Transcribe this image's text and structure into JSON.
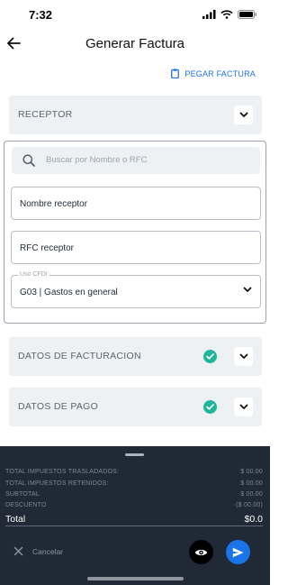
{
  "status": {
    "time": "7:32"
  },
  "header": {
    "title": "Generar Factura"
  },
  "paste": {
    "label": "PEGAR FACTURA"
  },
  "receptor": {
    "label": "RECEPTOR",
    "search_placeholder": "Buscar por Nombre o RFC",
    "name_value": "Nombre receptor",
    "rfc_value": "RFC receptor",
    "uso_label": "Uso CFDI",
    "uso_value": "G03 | Gastos en general"
  },
  "sections": {
    "facturacion": "DATOS DE FACTURACION",
    "pago": "DATOS DE PAGO"
  },
  "summary": {
    "rows": [
      {
        "label": "TOTAL IMPUESTOS TRASLADADOS:",
        "value": "$ 00.00"
      },
      {
        "label": "TOTAL IMPUESTOS RETENIDOS:",
        "value": "$ 00.00"
      },
      {
        "label": "SUBTOTAL",
        "value": "$ 00.00"
      },
      {
        "label": "DESCUENTO",
        "value": "($ 00.00)"
      }
    ],
    "total_label": "Total",
    "total_value": "$0.0"
  },
  "footer": {
    "cancel_label": "Cancelar"
  },
  "colors": {
    "accent": "#1a73e8",
    "success": "#23b59b",
    "sheet": "#1f2a36",
    "section_bg": "#eef1f4"
  },
  "icons": [
    "back-arrow-icon",
    "clipboard-icon",
    "chevron-down-icon",
    "check-circle-icon",
    "search-icon",
    "close-icon",
    "eye-icon",
    "send-icon"
  ]
}
